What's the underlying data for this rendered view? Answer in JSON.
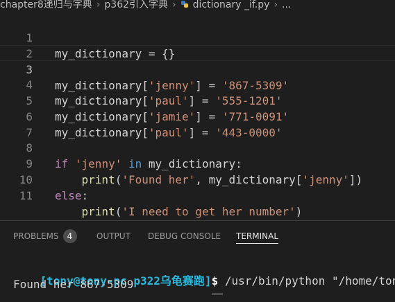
{
  "breadcrumb": {
    "folder1": "chapter8递归与字典",
    "folder2": "p362引入字典",
    "file": "dictionary _if.py",
    "ellipsis": "..."
  },
  "editor": {
    "line_numbers": [
      "1",
      "2",
      "3",
      "4",
      "5",
      "6",
      "7",
      "8",
      "9",
      "10",
      "11"
    ],
    "current_line": 3
  },
  "panel": {
    "tabs": [
      {
        "label": "PROBLEMS",
        "badge": "4"
      },
      {
        "label": "OUTPUT"
      },
      {
        "label": "DEBUG CONSOLE"
      },
      {
        "label": "TERMINAL"
      }
    ],
    "active_tab": "TERMINAL"
  },
  "terminal": {
    "prompt": "[tony@tony-pc p322乌龟赛跑]",
    "dollar": "$",
    "command": " /usr/bin/python \"/home/ton",
    "output": "Found her 867-5309"
  },
  "colors": {
    "background": "#1e1e1e",
    "string": "#ce9178",
    "keyword": "#c586c0",
    "function": "#dcdcaa",
    "prompt": "#29b8db"
  }
}
